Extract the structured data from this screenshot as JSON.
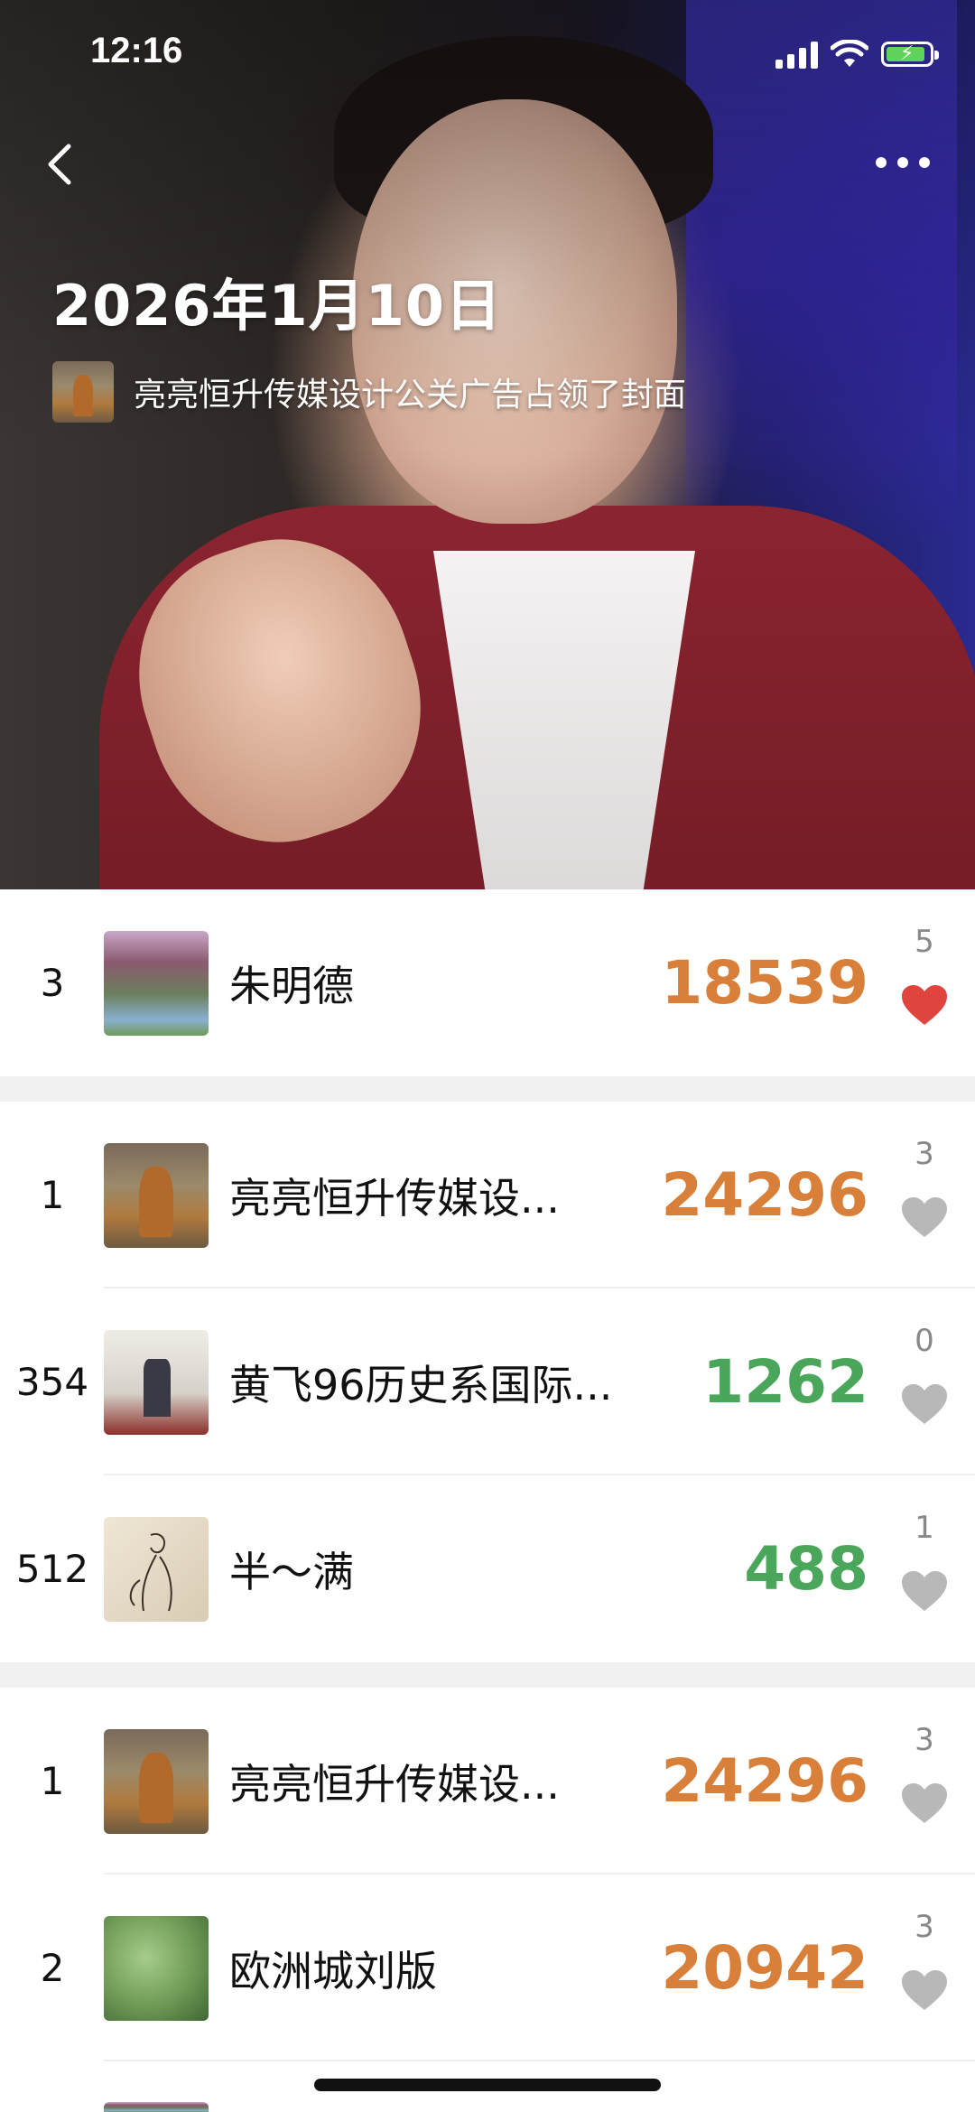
{
  "status_bar": {
    "time": "12:16"
  },
  "cover": {
    "date": "2026年1月10日",
    "owner_text": "亮亮恒升传媒设计公关广告占领了封面"
  },
  "my_entry": {
    "rank": "3",
    "name": "朱明德",
    "steps": "18539",
    "likes": "5",
    "liked": true,
    "steps_color": "#d8803a"
  },
  "group_a": [
    {
      "rank": "1",
      "name": "亮亮恒升传媒设...",
      "steps": "24296",
      "likes": "3",
      "steps_color": "#d8803a"
    },
    {
      "rank": "354",
      "name": "黄飞96历史系国际...",
      "steps": "1262",
      "likes": "0",
      "steps_color": "#4aa65a"
    },
    {
      "rank": "512",
      "name": "半～满",
      "steps": "488",
      "likes": "1",
      "steps_color": "#4aa65a"
    }
  ],
  "group_b": [
    {
      "rank": "1",
      "name": "亮亮恒升传媒设...",
      "steps": "24296",
      "likes": "3",
      "steps_color": "#d8803a"
    },
    {
      "rank": "2",
      "name": "欧洲城刘版",
      "steps": "20942",
      "likes": "3",
      "steps_color": "#d8803a"
    }
  ],
  "colors": {
    "heart_active": "#e0443e",
    "heart_inactive": "#b8b8b8",
    "steps_high": "#d8803a",
    "steps_low": "#4aa65a"
  }
}
